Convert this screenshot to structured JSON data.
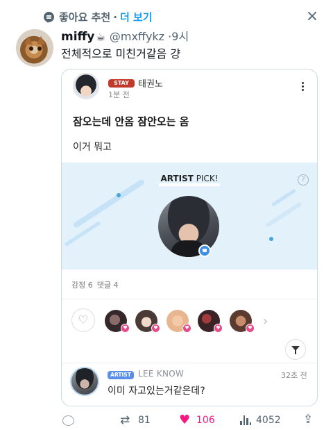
{
  "recommendation": {
    "text": "좋아요 추천",
    "separator": "·",
    "more": "더 보기"
  },
  "tweet": {
    "name": "miffy",
    "emoji": "☕",
    "handle": "@mxffykz",
    "time_separator": "·",
    "time": "9시",
    "text": "전체적으로 미친거같음 걍"
  },
  "card": {
    "badge": "STAY",
    "author": "태권노",
    "time": "1분 전",
    "title": "잠오는데 안옴 잠안오는 옴",
    "body": "이거 뭐고",
    "pick_bold": "ARTIST",
    "pick_rest": " PICK!",
    "help": "?",
    "stats": {
      "emotion": "감정 6",
      "comments": "댓글 4"
    },
    "comment": {
      "badge": "ARTIST",
      "author": "LEE KNOW",
      "time": "32초 전",
      "text": "이미 자고있는거같은데?"
    }
  },
  "actions": {
    "retweets": "81",
    "likes": "106",
    "views": "4052"
  },
  "colors": {
    "accent": "#1d9bf0",
    "like": "#f91880",
    "stay_badge": "#c0392b",
    "artist_badge": "#5b8ee6",
    "banner": "#e3f1fb"
  },
  "icons": [
    "recommend-icon",
    "close-icon",
    "more-options-icon",
    "help-icon",
    "chat-icon",
    "heart-icon",
    "chevron-right-icon",
    "filter-icon",
    "reply-icon",
    "retweet-icon",
    "like-icon",
    "views-icon",
    "share-icon"
  ]
}
